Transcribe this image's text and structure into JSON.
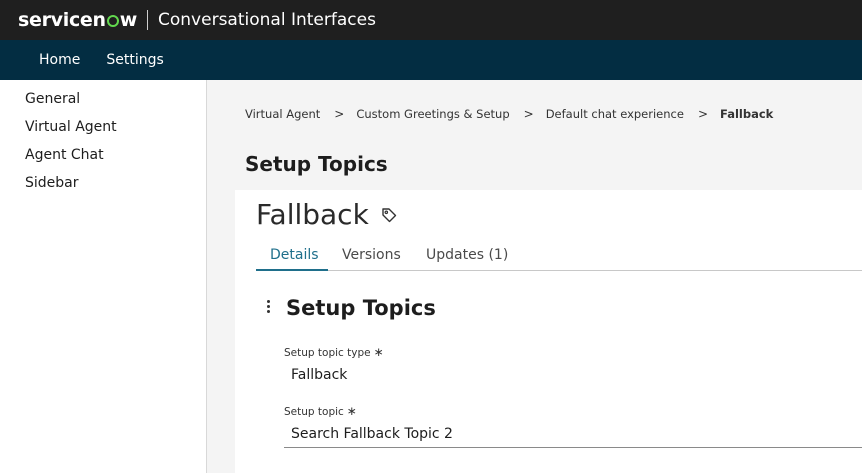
{
  "header": {
    "brand_parts": [
      "servicen",
      "w"
    ],
    "app_title": "Conversational Interfaces"
  },
  "nav": {
    "items": [
      {
        "label": "Home"
      },
      {
        "label": "Settings"
      }
    ]
  },
  "sidebar": {
    "items": [
      {
        "label": "General"
      },
      {
        "label": "Virtual Agent"
      },
      {
        "label": "Agent Chat"
      },
      {
        "label": "Sidebar"
      }
    ]
  },
  "breadcrumb": {
    "items": [
      "Virtual Agent",
      "Custom Greetings & Setup",
      "Default chat experience",
      "Fallback"
    ],
    "separator": ">"
  },
  "page": {
    "title": "Setup Topics"
  },
  "record": {
    "title": "Fallback",
    "tag_icon": "tag-icon",
    "tabs": [
      {
        "label": "Details",
        "active": true
      },
      {
        "label": "Versions"
      },
      {
        "label": "Updates (1)"
      }
    ],
    "section_title": "Setup Topics",
    "fields": [
      {
        "label": "Setup topic type",
        "required_mark": "∗",
        "value": "Fallback"
      },
      {
        "label": "Setup topic",
        "required_mark": "∗",
        "value": "Search Fallback Topic 2"
      }
    ]
  },
  "colors": {
    "topbar": "#1f1f1f",
    "navbar": "#032d42",
    "brand_accent": "#62d84e",
    "active_tab": "#1f6f8b"
  }
}
